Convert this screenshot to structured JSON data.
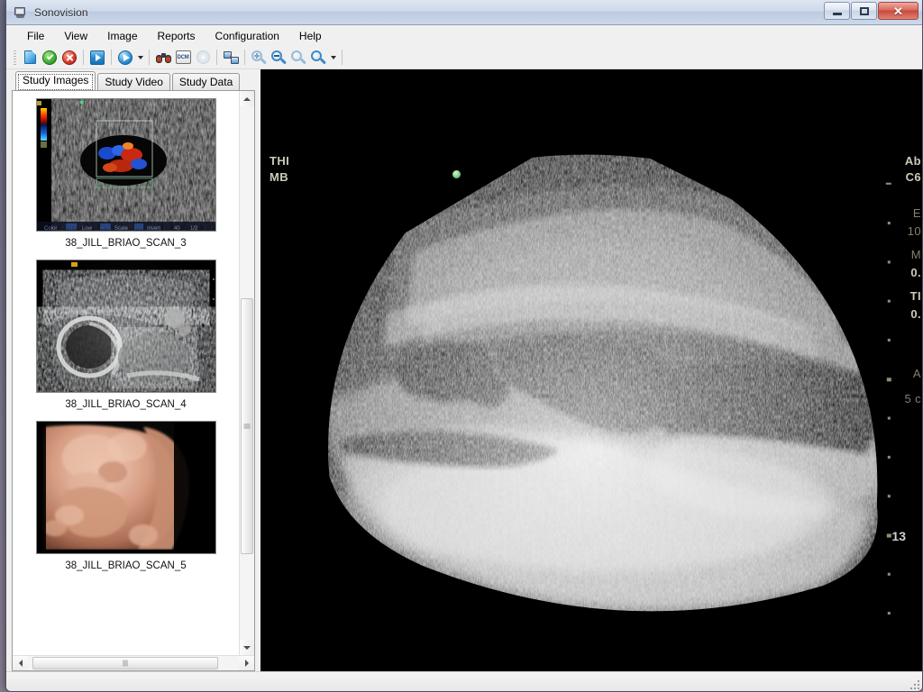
{
  "window": {
    "title": "Sonovision",
    "app_icon": "computer-icon",
    "controls": {
      "minimize": "minimize-icon",
      "maximize": "maximize-icon",
      "close": "✕"
    }
  },
  "menu": {
    "items": [
      {
        "label": "File"
      },
      {
        "label": "View"
      },
      {
        "label": "Image"
      },
      {
        "label": "Reports"
      },
      {
        "label": "Configuration"
      },
      {
        "label": "Help"
      }
    ]
  },
  "toolbar": {
    "buttons": [
      {
        "name": "new-study-icon",
        "tooltip": "New Study"
      },
      {
        "name": "accept-icon",
        "tooltip": "Accept"
      },
      {
        "name": "cancel-icon",
        "tooltip": "Cancel"
      },
      {
        "name": "export-icon",
        "tooltip": "Export"
      },
      {
        "name": "play-icon",
        "tooltip": "Play"
      },
      {
        "name": "binoculars-icon",
        "tooltip": "Find"
      },
      {
        "name": "dcm-icon",
        "tooltip": "DICOM",
        "label": "DCM"
      },
      {
        "name": "disc-icon",
        "tooltip": "Burn Disc"
      },
      {
        "name": "network-send-icon",
        "tooltip": "Send"
      },
      {
        "name": "zoom-in-icon",
        "tooltip": "Zoom In"
      },
      {
        "name": "zoom-out-icon",
        "tooltip": "Zoom Out"
      },
      {
        "name": "zoom-fit-icon",
        "tooltip": "Zoom Fit"
      },
      {
        "name": "zoom-area-icon",
        "tooltip": "Zoom Area"
      }
    ]
  },
  "tabs": [
    {
      "label": "Study Images",
      "active": true
    },
    {
      "label": "Study Video",
      "active": false
    },
    {
      "label": "Study Data",
      "active": false
    }
  ],
  "thumbnails": [
    {
      "label": "38_JILL_BRIAO_SCAN_3",
      "kind": "color-doppler"
    },
    {
      "label": "38_JILL_BRIAO_SCAN_4",
      "kind": "grayscale-fetal"
    },
    {
      "label": "38_JILL_BRIAO_SCAN_5",
      "kind": "3d-render"
    }
  ],
  "viewer": {
    "overlay_left": [
      {
        "text": "THI"
      },
      {
        "text": "MB"
      }
    ],
    "overlay_right": [
      {
        "text": "Ab"
      },
      {
        "text": "C6"
      },
      {
        "text": "E"
      },
      {
        "text": "10"
      },
      {
        "text": "M"
      },
      {
        "text": "0."
      },
      {
        "text": "TI"
      },
      {
        "text": "0."
      },
      {
        "text": "A"
      },
      {
        "text": "5 c"
      }
    ],
    "depth_marker": "13",
    "focus_marker": "focus-dot"
  },
  "scrollbars": {
    "vertical": {
      "up": "scroll-up-arrow",
      "down": "scroll-down-arrow"
    },
    "horizontal": {
      "left": "scroll-left-arrow",
      "right": "scroll-right-arrow"
    }
  },
  "colors": {
    "accent": "#2a8bd2",
    "close_button": "#c6493c",
    "accept": "#3cb033",
    "cancel": "#d8382a",
    "viewer_background": "#000000",
    "panel_background": "#f0f0f0",
    "overlay_text": "#c8cbb8"
  }
}
